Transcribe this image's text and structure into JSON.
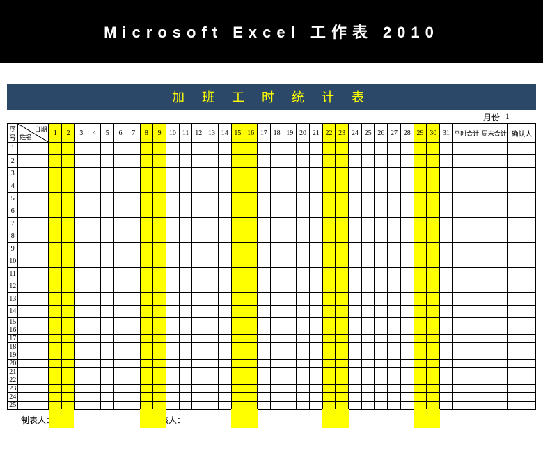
{
  "app_header": "Microsoft Excel 工作表 2010",
  "title": "加 班 工 时 统 计 表",
  "month_label": "月份",
  "month_value": "1",
  "header": {
    "seq": "序号",
    "date": "日期",
    "name": "姓名",
    "regular_sum": "平时合计",
    "weekend_sum": "周末合计",
    "confirm": "确认人"
  },
  "days": [
    1,
    2,
    3,
    4,
    5,
    6,
    7,
    8,
    9,
    10,
    11,
    12,
    13,
    14,
    15,
    16,
    17,
    18,
    19,
    20,
    21,
    22,
    23,
    24,
    25,
    26,
    27,
    28,
    29,
    30,
    31
  ],
  "weekend_days": [
    1,
    2,
    8,
    9,
    15,
    16,
    22,
    23,
    29,
    30
  ],
  "rows": [
    1,
    2,
    3,
    4,
    5,
    6,
    7,
    8,
    9,
    10,
    11,
    12,
    13,
    14,
    15,
    16,
    17,
    18,
    19,
    20,
    21,
    22,
    23,
    24,
    25
  ],
  "tall_rows": [
    1,
    2,
    3,
    4,
    5,
    6,
    7,
    8,
    9,
    10,
    11,
    12,
    13,
    14
  ],
  "footer": {
    "maker": "制表人：",
    "reviewer": "审核人："
  }
}
